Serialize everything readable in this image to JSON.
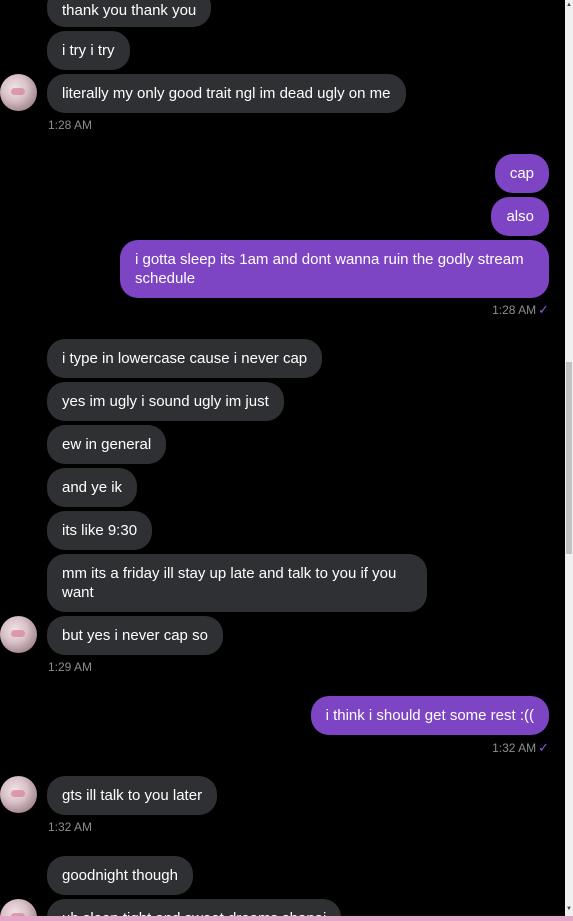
{
  "colors": {
    "background": "#000000",
    "incoming_bubble": "#2f3033",
    "outgoing_bubble": "#7d45c4",
    "timestamp": "#8a8d91",
    "read_check": "#8b5cd6"
  },
  "messages": [
    {
      "text": "thank you thank you",
      "from": "other"
    },
    {
      "text": "i try i try",
      "from": "other"
    },
    {
      "text": "literally my only good trait ngl im dead ugly on me",
      "from": "other"
    },
    {
      "text": "cap",
      "from": "me"
    },
    {
      "text": "also",
      "from": "me"
    },
    {
      "text": "i gotta sleep its 1am and dont wanna ruin the godly stream schedule",
      "from": "me"
    },
    {
      "text": "i type in lowercase cause i never cap",
      "from": "other"
    },
    {
      "text": "yes im ugly i sound ugly im just",
      "from": "other"
    },
    {
      "text": "ew in general",
      "from": "other"
    },
    {
      "text": "and ye ik",
      "from": "other"
    },
    {
      "text": "its like 9:30",
      "from": "other"
    },
    {
      "text": "mm its a friday ill stay up late and talk to you if you want",
      "from": "other"
    },
    {
      "text": "but yes i never cap so",
      "from": "other"
    },
    {
      "text": "i think i should get some rest :((",
      "from": "me"
    },
    {
      "text": "gts ill talk to you later",
      "from": "other"
    },
    {
      "text": "goodnight though",
      "from": "other"
    },
    {
      "text": "uh sleep tight and sweet dreams shanai",
      "from": "other"
    }
  ],
  "timestamps": [
    "1:28 AM",
    "1:28 AM",
    "1:29 AM",
    "1:32 AM",
    "1:32 AM"
  ],
  "read_mark": "✓",
  "scrollbar": {
    "up_arrow": "▲",
    "down_arrow": "▼"
  }
}
